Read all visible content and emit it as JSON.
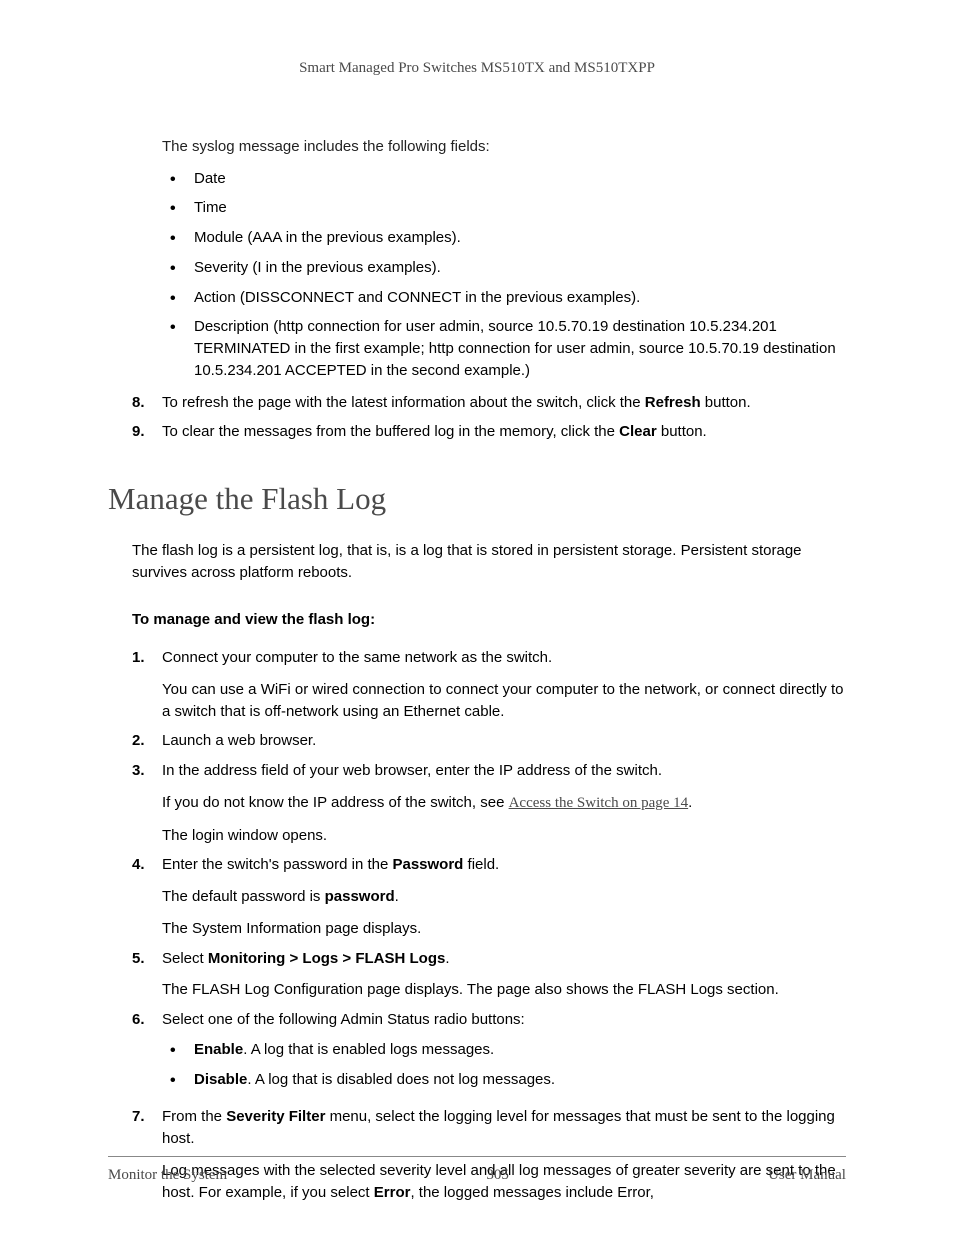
{
  "header": "Smart Managed Pro Switches MS510TX and MS510TXPP",
  "intro": "The syslog message includes the following fields:",
  "fields": {
    "b1": "Date",
    "b2": "Time",
    "b3": "Module (AAA in the previous examples).",
    "b4": "Severity (I in the previous examples).",
    "b5": "Action (DISSCONNECT and CONNECT in the previous examples).",
    "b6": "Description (http connection for user admin, source 10.5.70.19 destination 10.5.234.201 TERMINATED in the first example; http connection for user admin, source 10.5.70.19 destination 10.5.234.201 ACCEPTED in the second example.)"
  },
  "topsteps": {
    "s8": {
      "num": "8.",
      "pre": "To refresh the page with the latest information about the switch, click the ",
      "bold": "Refresh",
      "post": " button."
    },
    "s9": {
      "num": "9.",
      "pre": "To clear the messages from the buffered log in the memory, click the ",
      "bold": "Clear",
      "post": " button."
    }
  },
  "section_title": "Manage the Flash Log",
  "section_intro": "The flash log is a persistent log, that is, is a log that is stored in persistent storage. Persistent storage survives across platform reboots.",
  "subhead": "To manage and view the flash log:",
  "steps": {
    "s1": {
      "num": "1.",
      "t": "Connect your computer to the same network as the switch.",
      "p": "You can use a WiFi or wired connection to connect your computer to the network, or connect directly to a switch that is off-network using an Ethernet cable."
    },
    "s2": {
      "num": "2.",
      "t": "Launch a web browser."
    },
    "s3": {
      "num": "3.",
      "t": "In the address field of your web browser, enter the IP address of the switch.",
      "p_pre": "If you do not know the IP address of the switch, see ",
      "p_link": "Access the Switch on page 14",
      "p_post": ".",
      "p2": "The login window opens."
    },
    "s4": {
      "num": "4.",
      "t_pre": "Enter the switch's password in the ",
      "t_bold": "Password",
      "t_post": " field.",
      "p_pre": "The default password is ",
      "p_bold": "password",
      "p_post": ".",
      "p2": "The System Information page displays."
    },
    "s5": {
      "num": "5.",
      "t_pre": "Select ",
      "t_bold": "Monitoring > Logs > FLASH Logs",
      "t_post": ".",
      "p": "The FLASH Log Configuration page displays. The page also shows the FLASH Logs section."
    },
    "s6": {
      "num": "6.",
      "t": "Select one of the following Admin Status radio buttons:",
      "b1_bold": "Enable",
      "b1_post": ". A log that is enabled logs messages.",
      "b2_bold": "Disable",
      "b2_post": ". A log that is disabled does not log messages."
    },
    "s7": {
      "num": "7.",
      "t_pre": "From the ",
      "t_bold": "Severity Filter",
      "t_post": " menu, select the logging level for messages that must be sent to the logging host.",
      "p_pre": "Log messages with the selected severity level and all log messages of greater severity are sent to the host. For example, if you select ",
      "p_bold": "Error",
      "p_post": ", the logged messages include Error,"
    }
  },
  "footer": {
    "left": "Monitor the System",
    "center": "305",
    "right": "User Manual"
  }
}
